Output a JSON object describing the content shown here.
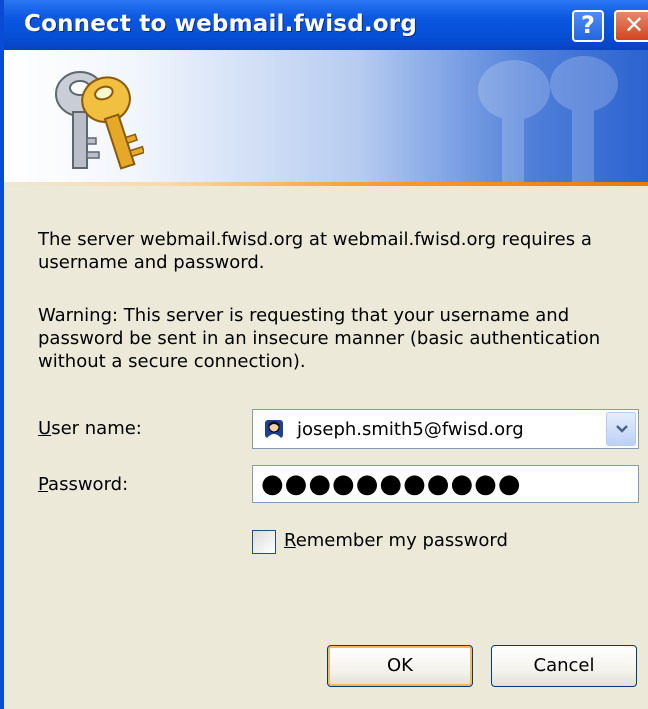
{
  "window": {
    "title": "Connect to webmail.fwisd.org",
    "help_glyph": "?",
    "close_glyph": "✕"
  },
  "banner": {
    "icon": "keys-icon"
  },
  "message": {
    "line1": "The server webmail.fwisd.org at webmail.fwisd.org requires a username and password.",
    "line2": "Warning: This server is requesting that your username and password be sent in an insecure manner (basic authentication without a secure connection)."
  },
  "form": {
    "username_label_accel": "U",
    "username_label_rest": "ser name:",
    "username_value": "joseph.smith5@fwisd.org",
    "password_label_accel": "P",
    "password_label_rest": "assword:",
    "password_value": "●●●●●●●●●●●",
    "remember_label_accel": "R",
    "remember_label_rest": "emember my password",
    "remember_checked": false
  },
  "buttons": {
    "ok": "OK",
    "cancel": "Cancel"
  },
  "colors": {
    "titlebar": "#0650d8",
    "dialog_bg": "#ece9d8",
    "accent_orange": "#f59f3d",
    "close_red": "#d2451f"
  }
}
